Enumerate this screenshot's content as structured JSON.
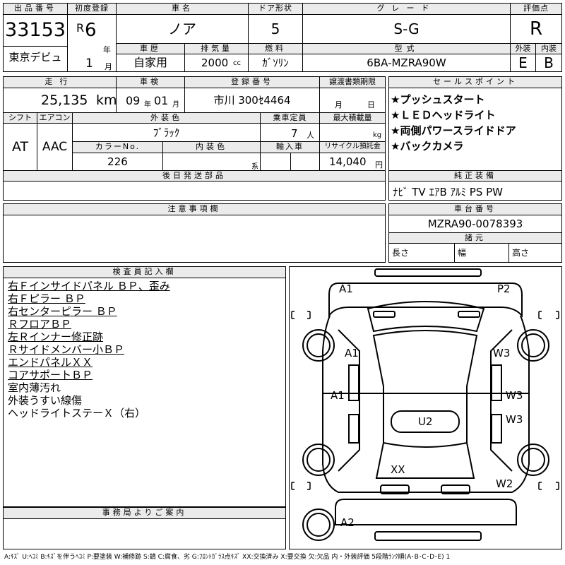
{
  "header": {
    "lot_label": "出品番号",
    "lot_number": "33153",
    "tokyo_debut": "東京デビュ",
    "first_reg_label": "初度登録",
    "era": "R",
    "era_year": "6",
    "year_unit": "年",
    "month": "1",
    "month_unit": "月",
    "car_name_label": "車名",
    "car_name": "ノア",
    "door_label": "ドア形状",
    "door": "5",
    "grade_label": "グレード",
    "grade": "S-G",
    "score_label": "評価点",
    "score": "R",
    "history_label": "車歴",
    "history": "自家用",
    "displacement_label": "排気量",
    "displacement": "2000",
    "displacement_unit": "cc",
    "fuel_label": "燃料",
    "fuel": "ｶﾞｿﾘﾝ",
    "model_label": "型式",
    "model": "6BA-MZRA90W",
    "exterior_label": "外装",
    "exterior_score": "E",
    "interior_label": "内装",
    "interior_score": "B"
  },
  "middle": {
    "mileage_label": "走行",
    "mileage": "25,135",
    "mileage_unit": "km",
    "inspection_label": "車検",
    "insp_year": "09",
    "insp_year_unit": "年",
    "insp_month": "01",
    "insp_month_unit": "月",
    "reg_no_label": "登録番号",
    "reg_no": "市川 300ｾ4464",
    "transfer_label": "譲渡書類期限",
    "transfer_month": "月",
    "transfer_day": "日",
    "shift_label": "シフト",
    "shift": "AT",
    "ac_label": "エアコン",
    "ac": "AAC",
    "ext_color_label": "外装色",
    "ext_color": "ﾌﾞﾗｯｸ",
    "capacity_label": "乗車定員",
    "capacity": "7",
    "capacity_unit": "人",
    "max_load_label": "最大積載量",
    "max_load_unit": "kg",
    "color_no_label": "カラーNo.",
    "color_no": "226",
    "int_color_label": "内装色",
    "int_color_unit": "系",
    "import_label": "輸入車",
    "recycle_label": "リサイクル預託金",
    "recycle": "14,040",
    "recycle_unit": "円",
    "later_parts_label": "後日発送部品"
  },
  "sales_points": {
    "label": "セールスポイント",
    "items": [
      "★プッシュスタート",
      "★ＬＥＤヘッドライト",
      "★両側パワースライドドア",
      "★バックカメラ"
    ]
  },
  "equipment": {
    "label": "純正装備",
    "value": "ﾅﾋﾞ TV ｴｱB ｱﾙﾐ PS PW"
  },
  "caution": {
    "label": "注意事項欄"
  },
  "chassis": {
    "label": "車台番号",
    "value": "MZRA90-0078393",
    "dims_label": "諸元",
    "length": "長さ",
    "width": "幅",
    "height": "高さ"
  },
  "inspector": {
    "label": "検査員記入欄",
    "lines": [
      "右Ｆインサイドパネル ＢＰ、歪み",
      "右Ｆピラー ＢＰ",
      "右センターピラー ＢＰ",
      "ＲフロアＢＰ",
      "左Ｒインナー修正跡",
      "Ｒサイドメンバー小ＢＰ",
      "エンドパネルＸＸ",
      "コアサポートＢＰ",
      "室内薄汚れ",
      "外装うすい線傷",
      "ヘッドライトステーＸ（右）"
    ]
  },
  "diagram": {
    "marks": [
      "A1",
      "P2",
      "A1",
      "W3",
      "A1",
      "W3",
      "W3",
      "U2",
      "XX",
      "W2",
      "A2"
    ]
  },
  "office": {
    "label": "事務局よりご案内"
  },
  "footer": {
    "legend": "A:ｷｽﾞ U:ﾍｺﾐ B:ｷｽﾞを伴うﾍｺﾐ P:要塗装 W:補修跡 S:錆 C:腐食、劣 G:ﾌﾛﾝﾄｶﾞﾗｽ点ｷｽﾞ XX:交換済み X:要交換 欠:欠品 内・外装評価 5段階ﾗﾝｸ順(A･B･C･D･E) 1"
  }
}
